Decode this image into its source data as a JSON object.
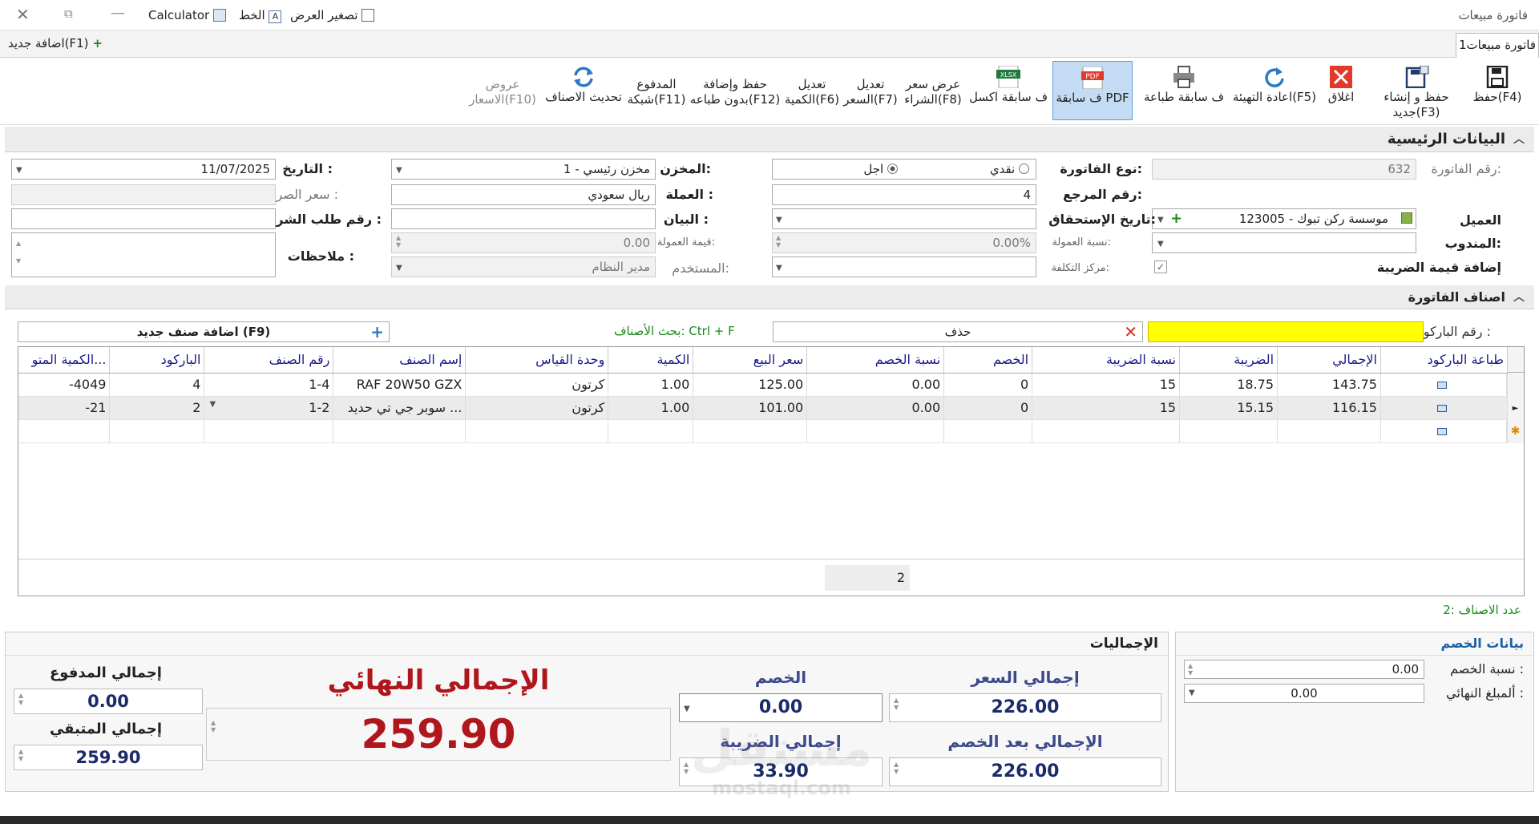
{
  "window": {
    "title": "فاتورة مبيعات",
    "calculator_label": "Calculator",
    "font_label": "الخط",
    "zoom_label": "تصغير العرض"
  },
  "tabs": {
    "active": "فاتورة مبيعات1",
    "add_new": "اضافة جديد(F1)"
  },
  "ribbon": [
    {
      "l1": "حفظ(F4)",
      "l2": "",
      "icon": "save-icon"
    },
    {
      "l1": "حفظ و إنشاء جديد(F3)",
      "l2": "",
      "icon": "save-new-icon"
    },
    {
      "l1": "اغلاق",
      "l2": "",
      "icon": "close-red-icon"
    },
    {
      "l1": "اعادة التهيئة(F5)",
      "l2": "",
      "icon": "reset-icon"
    },
    {
      "l1": "ف سابقة طباعة",
      "l2": "",
      "icon": "print-icon"
    },
    {
      "l1": "ف سابقة PDF",
      "l2": "",
      "icon": "pdf-icon"
    },
    {
      "l1": "ف سابقة اكسل",
      "l2": "",
      "icon": "xlsx-icon"
    },
    {
      "l1": "عرض سعر",
      "l2": "الشراء(F8)",
      "icon": ""
    },
    {
      "l1": "تعديل",
      "l2": "السعر(F7)",
      "icon": ""
    },
    {
      "l1": "تعديل",
      "l2": "الكمية(F6)",
      "icon": ""
    },
    {
      "l1": "حفظ وإضافة",
      "l2": "بدون طباعه(F12)",
      "icon": ""
    },
    {
      "l1": "المدفوع",
      "l2": "شبكة(F11)",
      "icon": ""
    },
    {
      "l1": "تحديث الاصناف",
      "l2": "",
      "icon": "refresh-icon"
    },
    {
      "l1": "عروض",
      "l2": "الاسعار(F10)",
      "icon": ""
    }
  ],
  "main": {
    "section_title": "البيانات الرئيسية",
    "invoice_no_label": "رقم الفاتورة:",
    "invoice_no": "632",
    "customer_label": "العميل",
    "customer": "123005 - موسسة ركن تبوك",
    "rep_label": "المندوب:",
    "rep": "",
    "tax_add_label": "إضافة قيمة الضريبة",
    "invoice_type_label": "نوع الفاتورة:",
    "cash": "نقدي",
    "credit": "اجل",
    "ref_label": "رقم المرجع:",
    "ref": "4",
    "due_label": "تاريخ الإستحقاق:",
    "due": "",
    "comm_rate_label": "نسبة العمولة:",
    "comm_rate": "0.00%",
    "cost_center_label": "مركز التكلفة:",
    "cost_center": "",
    "store_label": "المخزن:",
    "store": "1 - مخزن رئيسي",
    "currency_label": "العملة :",
    "currency": "ريال سعودي",
    "statement_label": "البيان :",
    "statement": "",
    "comm_value_label": "قيمة العمولة:",
    "comm_value": "0.00",
    "user_label": "المستخدم:",
    "user": "مدير النظام",
    "date_label": "التاريخ :",
    "date": "11/07/2025",
    "rate_label": "سعر الصرف :",
    "rate": "",
    "po_label": "رقم طلب الشراء :",
    "po": "",
    "notes_label": "ملاحظات :",
    "notes": ""
  },
  "items": {
    "section_title": "اصناف الفاتورة",
    "barcode_label": "رقم الباركود :",
    "barcode": "",
    "delete_label": "حذف",
    "search_hint": "بحث الأصناف: Ctrl + F",
    "add_item": "اضافة صنف جديد (F9)",
    "columns": [
      "الكمية المتو...",
      "الباركود",
      "رقم الصنف",
      "إسم الصنف",
      "وحدة القياس",
      "الكمية",
      "سعر البيع",
      "نسبة الخصم",
      "الخصم",
      "نسبة الضريبة",
      "الضريبة",
      "الإجمالي",
      "طباعة الباركود"
    ],
    "rows": [
      [
        "-4049",
        "4",
        "1-4",
        "RAF 20W50 GZX",
        "كرتون",
        "1.00",
        "125.00",
        "0.00",
        "0",
        "15",
        "18.75",
        "143.75",
        ""
      ],
      [
        "-21",
        "2",
        "1-2",
        "سوبر جي تي حديد ...",
        "كرتون",
        "1.00",
        "101.00",
        "0.00",
        "0",
        "15",
        "15.15",
        "116.15",
        ""
      ]
    ],
    "footer_count": "2",
    "count_label": "عدد الاصناف :2"
  },
  "totals": {
    "title": "الإجماليات",
    "gross_label": "إجمالي السعر",
    "gross": "226.00",
    "discount_label": "الخصم",
    "discount": "0.00",
    "net_label": "الإجمالي بعد الخصم",
    "net": "226.00",
    "tax_label": "إجمالي الضريبة",
    "tax": "33.90",
    "final_label": "الإجمالي النهائي",
    "final": "259.90",
    "paid_label": "إجمالي المدفوع",
    "paid": "0.00",
    "remaining_label": "إجمالي المتبقي",
    "remaining": "259.90"
  },
  "discount_panel": {
    "title": "بيانات الخصم",
    "rate_label": "نسبة الخصم :",
    "rate": "0.00",
    "final_label": "ألمبلغ النهائي :",
    "final": "0.00"
  },
  "watermark": {
    "text": "مستقل",
    "sub": "mostaql.com"
  },
  "colors": {
    "accent": "#1a5fa8",
    "final_red": "#b0171c",
    "total_blue": "#3d4a8a",
    "barcode_yellow": "#ffff00",
    "link_green": "#1a8a1a"
  }
}
